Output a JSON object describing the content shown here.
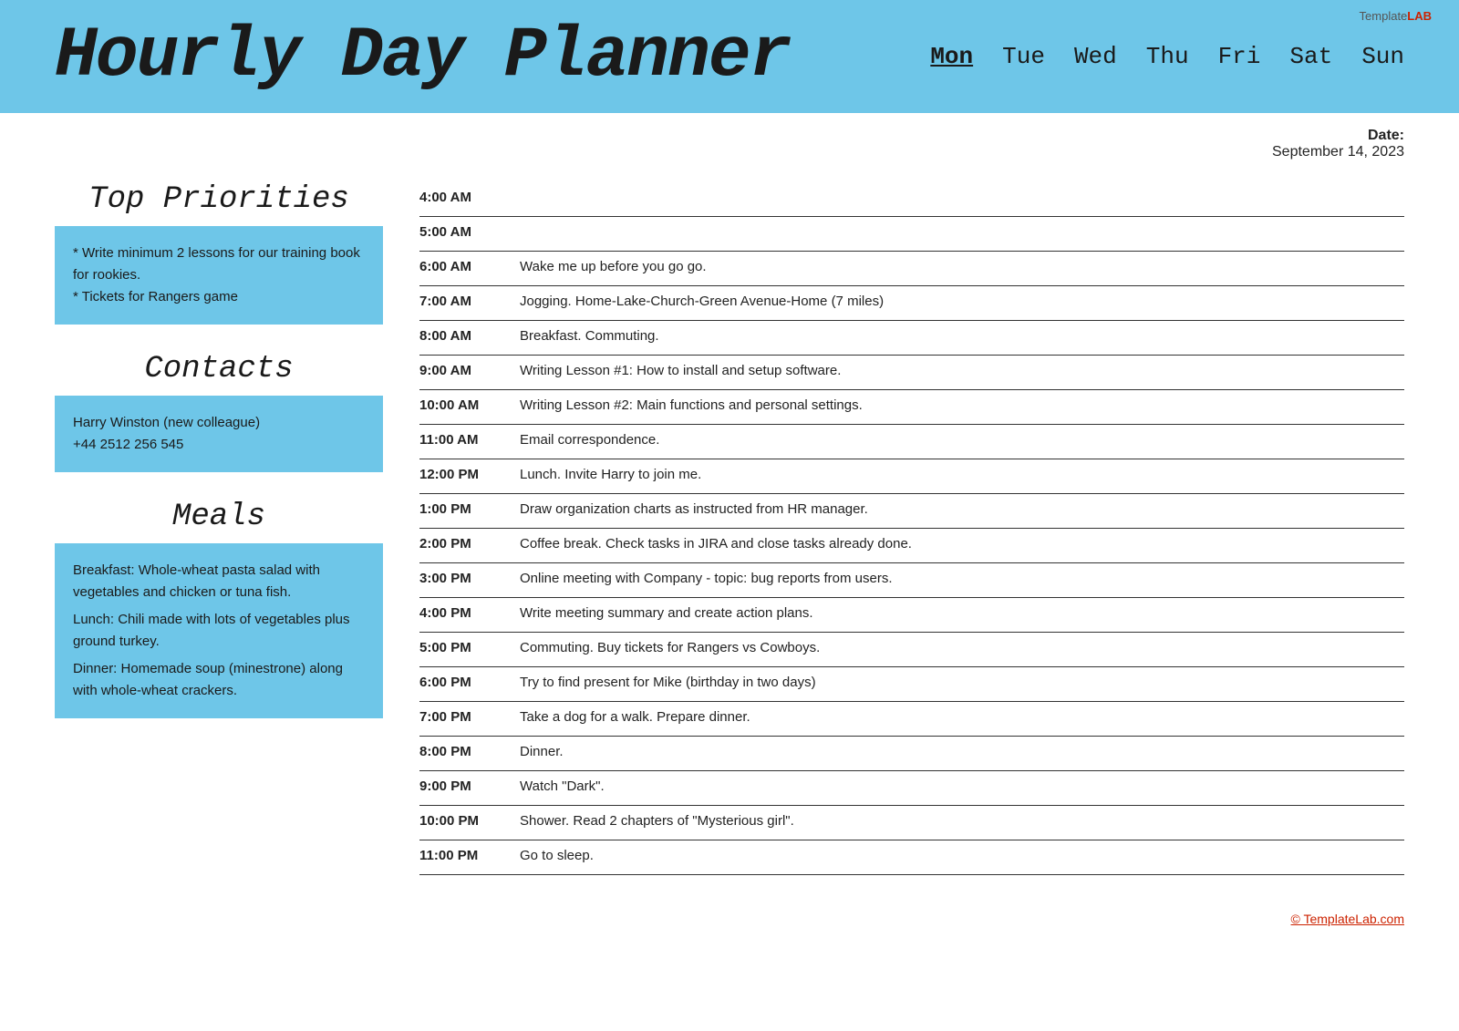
{
  "branding": {
    "template": "Template",
    "lab": "LAB"
  },
  "header": {
    "title": "Hourly Day Planner",
    "days": [
      "Mon",
      "Tue",
      "Wed",
      "Thu",
      "Fri",
      "Sat",
      "Sun"
    ],
    "active_day": "Mon"
  },
  "date": {
    "label": "Date:",
    "value": "September 14, 2023"
  },
  "priorities": {
    "heading": "Top Priorities",
    "items": [
      "* Write minimum 2 lessons for our training book for rookies.",
      "* Tickets for Rangers game"
    ]
  },
  "contacts": {
    "heading": "Contacts",
    "lines": [
      "Harry Winston (new colleague)",
      "+44 2512 256 545"
    ]
  },
  "meals": {
    "heading": "Meals",
    "lines": [
      "Breakfast: Whole-wheat pasta salad with vegetables and chicken or tuna fish.",
      "Lunch: Chili made with lots of vegetables plus ground turkey.",
      "Dinner: Homemade soup (minestrone) along with whole-wheat crackers."
    ]
  },
  "schedule": [
    {
      "time": "4:00 AM",
      "event": ""
    },
    {
      "time": "5:00 AM",
      "event": ""
    },
    {
      "time": "6:00 AM",
      "event": "Wake me up before you go go."
    },
    {
      "time": "7:00 AM",
      "event": "Jogging. Home-Lake-Church-Green Avenue-Home (7 miles)"
    },
    {
      "time": "8:00 AM",
      "event": "Breakfast. Commuting."
    },
    {
      "time": "9:00 AM",
      "event": "Writing Lesson #1: How to install and setup software."
    },
    {
      "time": "10:00 AM",
      "event": "Writing Lesson #2: Main functions and personal settings."
    },
    {
      "time": "11:00 AM",
      "event": "Email correspondence."
    },
    {
      "time": "12:00 PM",
      "event": "Lunch. Invite Harry to join me."
    },
    {
      "time": "1:00 PM",
      "event": "Draw organization charts as instructed from HR manager."
    },
    {
      "time": "2:00 PM",
      "event": "Coffee break. Check tasks in JIRA and close tasks already done."
    },
    {
      "time": "3:00 PM",
      "event": "Online meeting with Company - topic: bug reports from users."
    },
    {
      "time": "4:00 PM",
      "event": "Write meeting summary and create action plans."
    },
    {
      "time": "5:00 PM",
      "event": "Commuting. Buy tickets for Rangers vs Cowboys."
    },
    {
      "time": "6:00 PM",
      "event": "Try to find present for Mike (birthday in two days)"
    },
    {
      "time": "7:00 PM",
      "event": "Take a dog for a walk. Prepare dinner."
    },
    {
      "time": "8:00 PM",
      "event": "Dinner."
    },
    {
      "time": "9:00 PM",
      "event": "Watch \"Dark\"."
    },
    {
      "time": "10:00 PM",
      "event": "Shower. Read 2 chapters of \"Mysterious girl\"."
    },
    {
      "time": "11:00 PM",
      "event": "Go to sleep."
    }
  ],
  "footer": {
    "link_text": "© TemplateLab.com"
  }
}
